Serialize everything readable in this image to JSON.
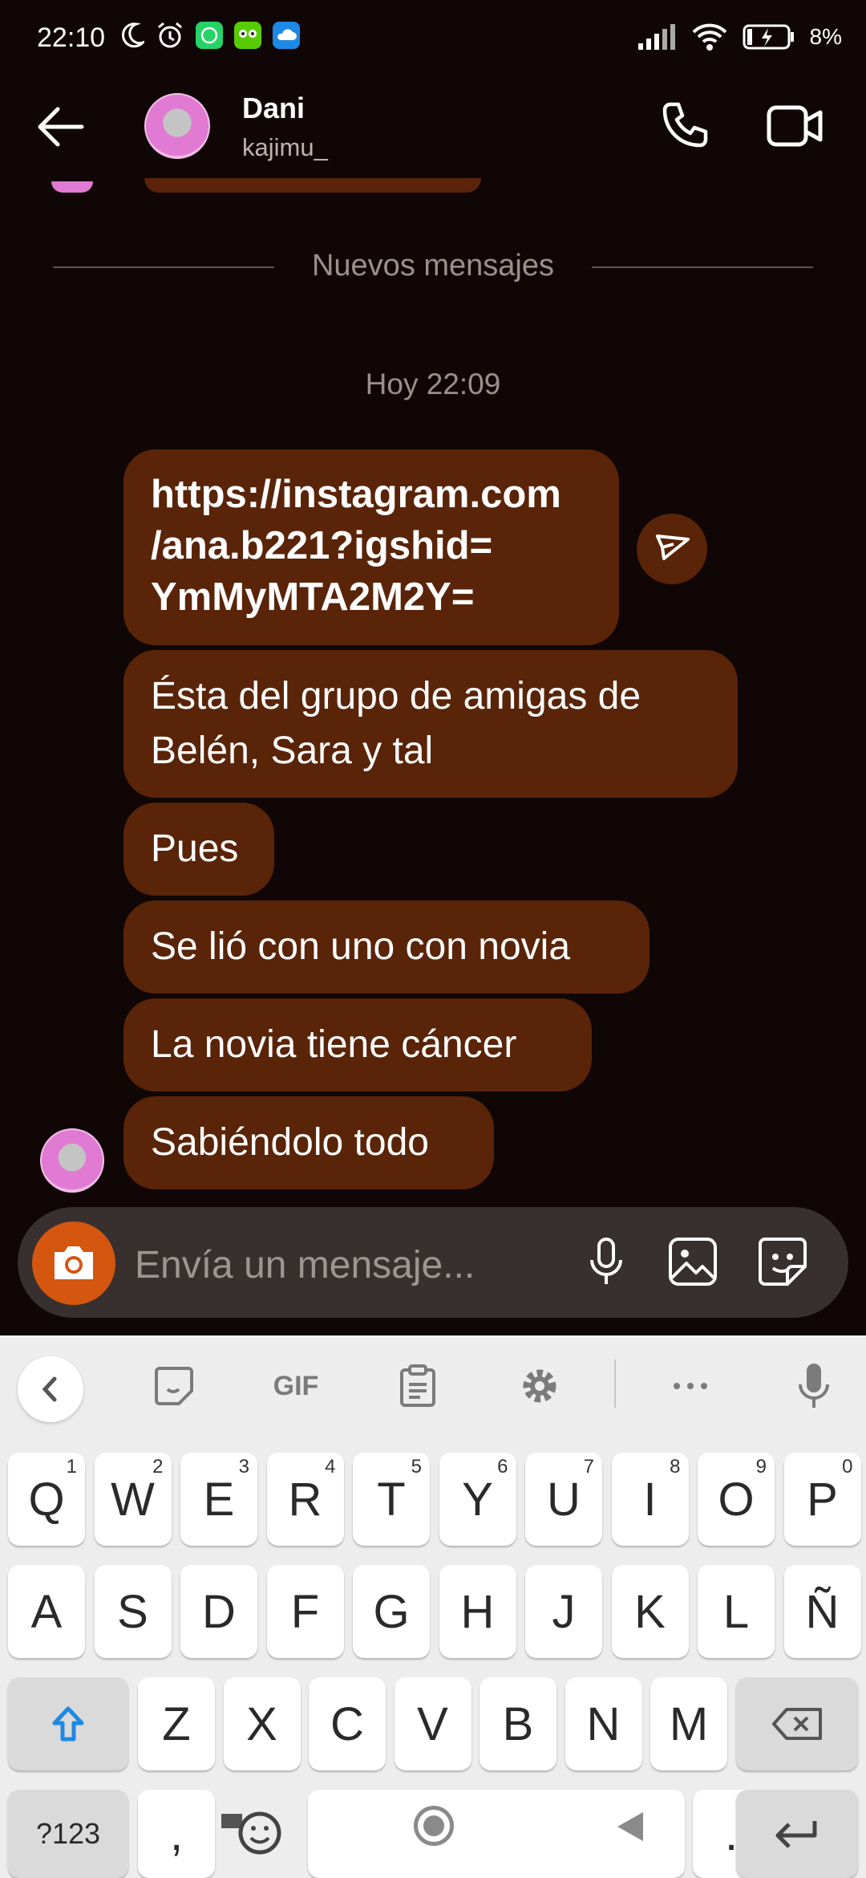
{
  "status_bar": {
    "time": "22:10",
    "battery": "8%",
    "icons": [
      "moon-icon",
      "alarm-icon",
      "whatsapp-icon",
      "duolingo-icon",
      "cloud-icon",
      "signal-icon",
      "wifi-icon",
      "battery-icon"
    ]
  },
  "header": {
    "name": "Dani",
    "username": "kajimu_"
  },
  "chat": {
    "divider_label": "Nuevos mensajes",
    "timestamp": "Hoy 22:09",
    "messages": [
      {
        "text": "https://instagram.com\n/ana.b221?igshid=\nYmMyMTA2M2Y="
      },
      {
        "text": "Ésta del grupo de amigas de\nBelén, Sara y tal"
      },
      {
        "text": "Pues"
      },
      {
        "text": "Se lió con uno con novia"
      },
      {
        "text": "La novia tiene cáncer"
      },
      {
        "text": "Sabiéndolo todo"
      }
    ]
  },
  "composer": {
    "placeholder": "Envía un mensaje..."
  },
  "keyboard": {
    "toolbar_gif": "GIF",
    "row1": [
      {
        "k": "Q",
        "n": "1"
      },
      {
        "k": "W",
        "n": "2"
      },
      {
        "k": "E",
        "n": "3"
      },
      {
        "k": "R",
        "n": "4"
      },
      {
        "k": "T",
        "n": "5"
      },
      {
        "k": "Y",
        "n": "6"
      },
      {
        "k": "U",
        "n": "7"
      },
      {
        "k": "I",
        "n": "8"
      },
      {
        "k": "O",
        "n": "9"
      },
      {
        "k": "P",
        "n": "0"
      }
    ],
    "row2": [
      "A",
      "S",
      "D",
      "F",
      "G",
      "H",
      "J",
      "K",
      "L",
      "Ñ"
    ],
    "row3": [
      "Z",
      "X",
      "C",
      "V",
      "B",
      "N",
      "M"
    ],
    "symbols_label": "?123",
    "comma": ",",
    "period": "."
  },
  "colors": {
    "background": "#0f0605",
    "bubble": "#5a2409",
    "camera_button": "#d4560f",
    "keyboard": "#ededed"
  }
}
